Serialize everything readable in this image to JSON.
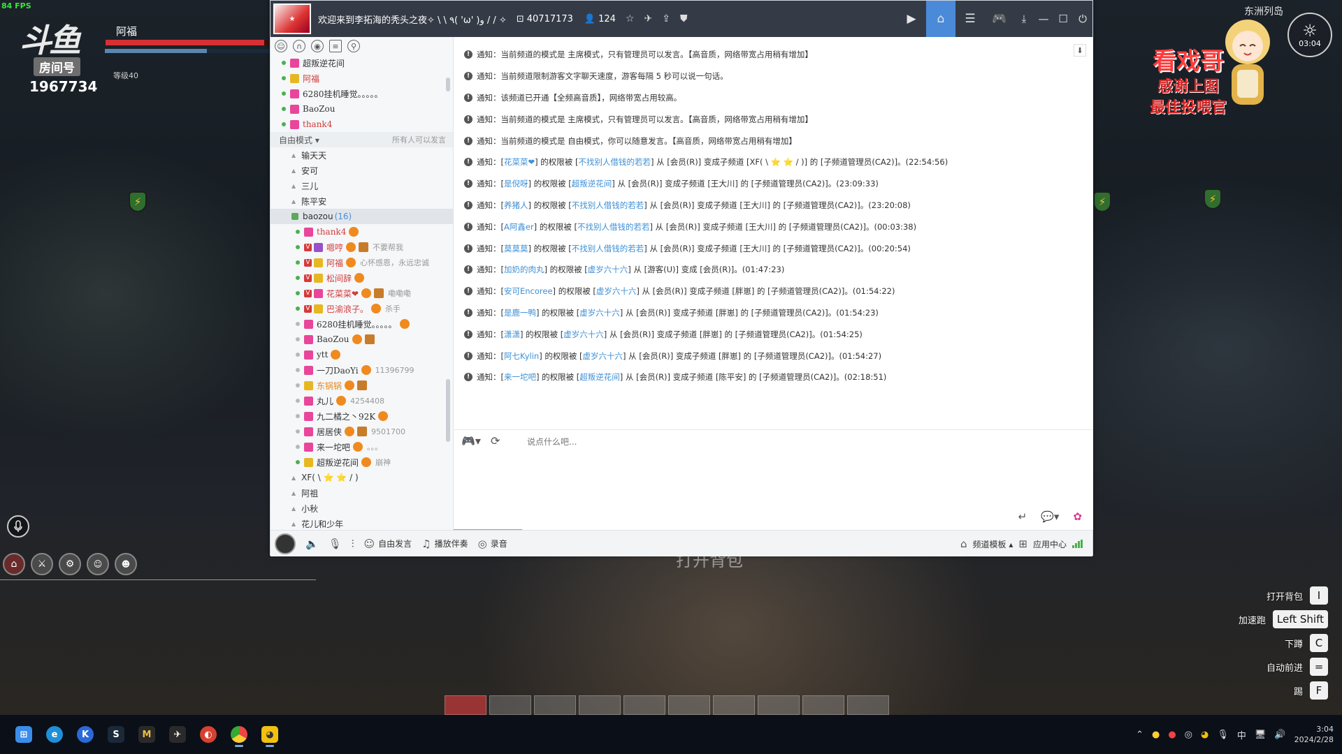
{
  "game": {
    "fps": "84 FPS",
    "logo_text": "斗鱼",
    "room_tag": "房间号",
    "room_number": "1967734",
    "player_name": "阿福",
    "level": "等级40",
    "hp_fraction": 0.97,
    "mp_fraction": 0.62,
    "prompt_text": "打开背包",
    "region": "东洲列岛",
    "clock_time": "03:04",
    "overlay_title": "看戏哥",
    "overlay_line1": "感谢上图",
    "overlay_line2": "最佳投喂官",
    "shield_glyph": "⚡",
    "keyhints": [
      {
        "label": "打开背包",
        "key": "I"
      },
      {
        "label": "加速跑",
        "key": "Left Shift"
      },
      {
        "label": "下蹲",
        "key": "C"
      },
      {
        "label": "自动前进",
        "key": "="
      },
      {
        "label": "踢",
        "key": "F"
      }
    ]
  },
  "client": {
    "title": "欢迎来到李拓海的秃头之夜✧ \\ \\ ٩( 'ω' )و / / ✧",
    "channel_id": "40717173",
    "online_count": "124",
    "mode_label": "自由模式",
    "mode_right": "所有人可以发言",
    "top_members": [
      {
        "name": "超叛逆花间",
        "online": true,
        "red": false
      },
      {
        "name": "阿福",
        "online": true,
        "red": true
      },
      {
        "name": "6280挂机睡觉。。。。。",
        "online": true,
        "red": false
      },
      {
        "name": "BaoZou",
        "online": true,
        "red": false
      },
      {
        "name": "thank4",
        "online": true,
        "red": true
      }
    ],
    "channels_top": [
      "输天天",
      "安可",
      "三儿",
      "陈平安"
    ],
    "current_channel": "baozou",
    "current_channel_count": "(16)",
    "members": [
      {
        "name": "thank4",
        "v": false,
        "online": true,
        "color": "red",
        "rank": "pink",
        "note": ""
      },
      {
        "name": "嗯哼",
        "v": true,
        "online": true,
        "color": "red",
        "rank": "purple",
        "note": "不要帮我"
      },
      {
        "name": "阿福",
        "v": true,
        "online": true,
        "color": "red",
        "rank": "gold",
        "note": "心怀感恩，永远忠诚"
      },
      {
        "name": "松间辞",
        "v": true,
        "online": true,
        "color": "red",
        "rank": "gold",
        "note": ""
      },
      {
        "name": "花菜菜❤",
        "v": true,
        "online": true,
        "color": "red",
        "rank": "pink",
        "note": "嘞嘞嘞"
      },
      {
        "name": "巴渝浪子。",
        "v": true,
        "online": true,
        "color": "red",
        "rank": "gold",
        "note": "杀手"
      },
      {
        "name": "6280挂机睡觉。。。。。",
        "v": false,
        "online": false,
        "color": "dark",
        "rank": "pink",
        "note": ""
      },
      {
        "name": "BaoZou",
        "v": false,
        "online": false,
        "color": "dark",
        "rank": "pink",
        "note": ""
      },
      {
        "name": "ytt",
        "v": false,
        "online": false,
        "color": "dark",
        "rank": "pink",
        "note": ""
      },
      {
        "name": "一刀DaoYi",
        "v": false,
        "online": false,
        "color": "dark",
        "rank": "pink",
        "note": "11396799"
      },
      {
        "name": "东锅锅",
        "v": false,
        "online": false,
        "color": "orange",
        "rank": "gold",
        "note": ""
      },
      {
        "name": "丸儿",
        "v": false,
        "online": false,
        "color": "dark",
        "rank": "pink",
        "note": "4254408"
      },
      {
        "name": "九二橘之丶92K",
        "v": false,
        "online": false,
        "color": "dark",
        "rank": "pink",
        "note": ""
      },
      {
        "name": "居居侠",
        "v": false,
        "online": false,
        "color": "dark",
        "rank": "pink",
        "note": "9501700"
      },
      {
        "name": "来一坨吧",
        "v": false,
        "online": false,
        "color": "dark",
        "rank": "pink",
        "note": "。。。"
      },
      {
        "name": "超叛逆花间",
        "v": false,
        "online": true,
        "color": "dark",
        "rank": "gold",
        "note": "崩神"
      }
    ],
    "channels_bottom": [
      "XF( \\ ⭐ ⭐ / )",
      "阿祖",
      "小秋",
      "花儿和少年"
    ],
    "messages": [
      {
        "pre": "通知：当前频道的模式是 主席模式，只有管理员可以发言。【高音质，网络带宽占用稍有增加】",
        "l1": "",
        "mid": "",
        "l2": "",
        "post": ""
      },
      {
        "pre": "通知：当前频道限制游客文字聊天速度，游客每隔 5 秒可以说一句话。",
        "l1": "",
        "mid": "",
        "l2": "",
        "post": ""
      },
      {
        "pre": "通知：该频道已开通【全频高音质】，网络带宽占用较高。",
        "l1": "",
        "mid": "",
        "l2": "",
        "post": ""
      },
      {
        "pre": "通知：当前频道的模式是 主席模式，只有管理员可以发言。【高音质，网络带宽占用稍有增加】",
        "l1": "",
        "mid": "",
        "l2": "",
        "post": ""
      },
      {
        "pre": "通知：当前频道的模式是 自由模式，你可以随意发言。【高音质，网络带宽占用稍有增加】",
        "l1": "",
        "mid": "",
        "l2": "",
        "post": ""
      },
      {
        "pre": "通知：[",
        "l1": "花菜菜❤",
        "mid": "] 的权限被 [",
        "l2": "不找别人借钱的若若",
        "post": "] 从 [会员(R)] 变成子频道 [XF( \\ ⭐ ⭐ / )] 的 [子频道管理员(CA2)]。(22:54:56)"
      },
      {
        "pre": "通知：[",
        "l1": "是倪呀",
        "mid": "] 的权限被 [",
        "l2": "超叛逆花间",
        "post": "] 从 [会员(R)] 变成子频道 [王大川] 的 [子频道管理员(CA2)]。(23:09:33)"
      },
      {
        "pre": "通知：[",
        "l1": "养猪人",
        "mid": "] 的权限被 [",
        "l2": "不找别人借钱的若若",
        "post": "] 从 [会员(R)] 变成子频道 [王大川] 的 [子频道管理员(CA2)]。(23:20:08)"
      },
      {
        "pre": "通知：[",
        "l1": "A阿鑫er",
        "mid": "] 的权限被 [",
        "l2": "不找别人借钱的若若",
        "post": "] 从 [会员(R)] 变成子频道 [王大川] 的 [子频道管理员(CA2)]。(00:03:38)"
      },
      {
        "pre": "通知：[",
        "l1": "莫莫莫",
        "mid": "] 的权限被 [",
        "l2": "不找别人借钱的若若",
        "post": "] 从 [会员(R)] 变成子频道 [王大川] 的 [子频道管理员(CA2)]。(00:20:54)"
      },
      {
        "pre": "通知：[",
        "l1": "加奶的肉丸",
        "mid": "] 的权限被 [",
        "l2": "虚岁六十六",
        "post": "] 从 [游客(U)] 变成 [会员(R)]。(01:47:23)"
      },
      {
        "pre": "通知：[",
        "l1": "安可Encoree",
        "mid": "] 的权限被 [",
        "l2": "虚岁六十六",
        "post": "] 从 [会员(R)] 变成子频道 [胖崽] 的 [子频道管理员(CA2)]。(01:54:22)"
      },
      {
        "pre": "通知：[",
        "l1": "是鹿一鸭",
        "mid": "] 的权限被 [",
        "l2": "虚岁六十六",
        "post": "] 从 [会员(R)] 变成子频道 [胖崽] 的 [子频道管理员(CA2)]。(01:54:23)"
      },
      {
        "pre": "通知：[",
        "l1": "潇潇",
        "mid": "] 的权限被 [",
        "l2": "虚岁六十六",
        "post": "] 从 [会员(R)] 变成子频道 [胖崽] 的 [子频道管理员(CA2)]。(01:54:25)"
      },
      {
        "pre": "通知：[",
        "l1": "阿七Kylin",
        "mid": "] 的权限被 [",
        "l2": "虚岁六十六",
        "post": "] 从 [会员(R)] 变成子频道 [胖崽] 的 [子频道管理员(CA2)]。(01:54:27)"
      },
      {
        "pre": "通知：[",
        "l1": "来一坨吧",
        "mid": "] 的权限被 [",
        "l2": "超叛逆花间",
        "post": "] 从 [会员(R)] 变成子频道 [陈平安] 的 [子频道管理员(CA2)]。(02:18:51)"
      }
    ],
    "input_placeholder": "说点什么吧...",
    "bottom": {
      "free_speech": "自由发言",
      "accompany": "播放伴奏",
      "record": "录音",
      "template": "频道模板",
      "app_center": "应用中心"
    }
  },
  "taskbar": {
    "apps": [
      "windows-start",
      "edge",
      "kook",
      "steam",
      "app-m",
      "app-bird",
      "app-red",
      "chrome",
      "yy"
    ],
    "ime": "中",
    "time": "3:04",
    "date": "2024/2/28"
  }
}
